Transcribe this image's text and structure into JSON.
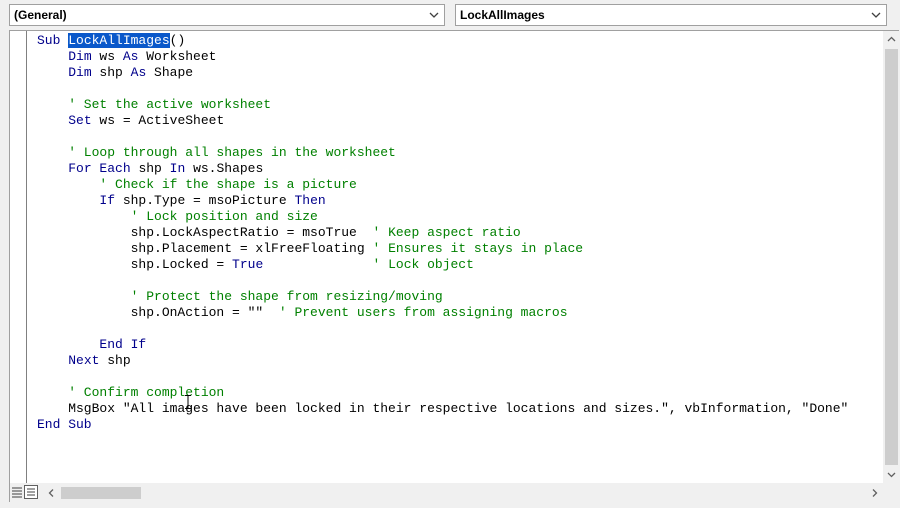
{
  "object_combo": {
    "value": "(General)"
  },
  "procedure_combo": {
    "value": "LockAllImages"
  },
  "code": {
    "lines": [
      [
        {
          "t": "Sub ",
          "c": "kw"
        },
        {
          "t": "LockAllImages",
          "c": "sel"
        },
        {
          "t": "()",
          "c": ""
        }
      ],
      [
        {
          "t": "    ",
          "c": ""
        },
        {
          "t": "Dim",
          "c": "kw"
        },
        {
          "t": " ws ",
          "c": ""
        },
        {
          "t": "As",
          "c": "kw"
        },
        {
          "t": " Worksheet",
          "c": ""
        }
      ],
      [
        {
          "t": "    ",
          "c": ""
        },
        {
          "t": "Dim",
          "c": "kw"
        },
        {
          "t": " shp ",
          "c": ""
        },
        {
          "t": "As",
          "c": "kw"
        },
        {
          "t": " Shape",
          "c": ""
        }
      ],
      [],
      [
        {
          "t": "    ' Set the active worksheet",
          "c": "cm"
        }
      ],
      [
        {
          "t": "    ",
          "c": ""
        },
        {
          "t": "Set",
          "c": "kw"
        },
        {
          "t": " ws = ActiveSheet",
          "c": ""
        }
      ],
      [],
      [
        {
          "t": "    ' Loop through all shapes in the worksheet",
          "c": "cm"
        }
      ],
      [
        {
          "t": "    ",
          "c": ""
        },
        {
          "t": "For Each",
          "c": "kw"
        },
        {
          "t": " shp ",
          "c": ""
        },
        {
          "t": "In",
          "c": "kw"
        },
        {
          "t": " ws.Shapes",
          "c": ""
        }
      ],
      [
        {
          "t": "        ' Check if the shape is a picture",
          "c": "cm"
        }
      ],
      [
        {
          "t": "        ",
          "c": ""
        },
        {
          "t": "If",
          "c": "kw"
        },
        {
          "t": " shp.Type = msoPicture ",
          "c": ""
        },
        {
          "t": "Then",
          "c": "kw"
        }
      ],
      [
        {
          "t": "            ' Lock position and size",
          "c": "cm"
        }
      ],
      [
        {
          "t": "            shp.LockAspectRatio = msoTrue  ",
          "c": ""
        },
        {
          "t": "' Keep aspect ratio",
          "c": "cm"
        }
      ],
      [
        {
          "t": "            shp.Placement = xlFreeFloating ",
          "c": ""
        },
        {
          "t": "' Ensures it stays in place",
          "c": "cm"
        }
      ],
      [
        {
          "t": "            shp.Locked = ",
          "c": ""
        },
        {
          "t": "True",
          "c": "kw"
        },
        {
          "t": "              ",
          "c": ""
        },
        {
          "t": "' Lock object",
          "c": "cm"
        }
      ],
      [],
      [
        {
          "t": "            ' Protect the shape from resizing/moving",
          "c": "cm"
        }
      ],
      [
        {
          "t": "            shp.OnAction = \"\"  ",
          "c": ""
        },
        {
          "t": "' Prevent users from assigning macros",
          "c": "cm"
        }
      ],
      [],
      [
        {
          "t": "        ",
          "c": ""
        },
        {
          "t": "End If",
          "c": "kw"
        }
      ],
      [
        {
          "t": "    ",
          "c": ""
        },
        {
          "t": "Next",
          "c": "kw"
        },
        {
          "t": " shp",
          "c": ""
        }
      ],
      [],
      [
        {
          "t": "    ' Confirm completion",
          "c": "cm"
        }
      ],
      [
        {
          "t": "    MsgBox \"All images have been locked in their respective locations and sizes.\", vbInformation, \"Done\"",
          "c": ""
        }
      ],
      [
        {
          "t": "End Sub",
          "c": "kw"
        }
      ]
    ]
  },
  "icons": {
    "combo_arrow": "chevron-down-icon",
    "scroll_up": "triangle-up-icon",
    "scroll_down": "triangle-down-icon",
    "scroll_left": "triangle-left-icon",
    "scroll_right": "triangle-right-icon",
    "procedure_view": "procedure-view-icon",
    "full_module_view": "full-module-view-icon",
    "text_cursor": "i-beam-cursor-icon"
  },
  "colors": {
    "keyword": "#00008b",
    "comment": "#008000",
    "selection": "#0a58ca"
  }
}
